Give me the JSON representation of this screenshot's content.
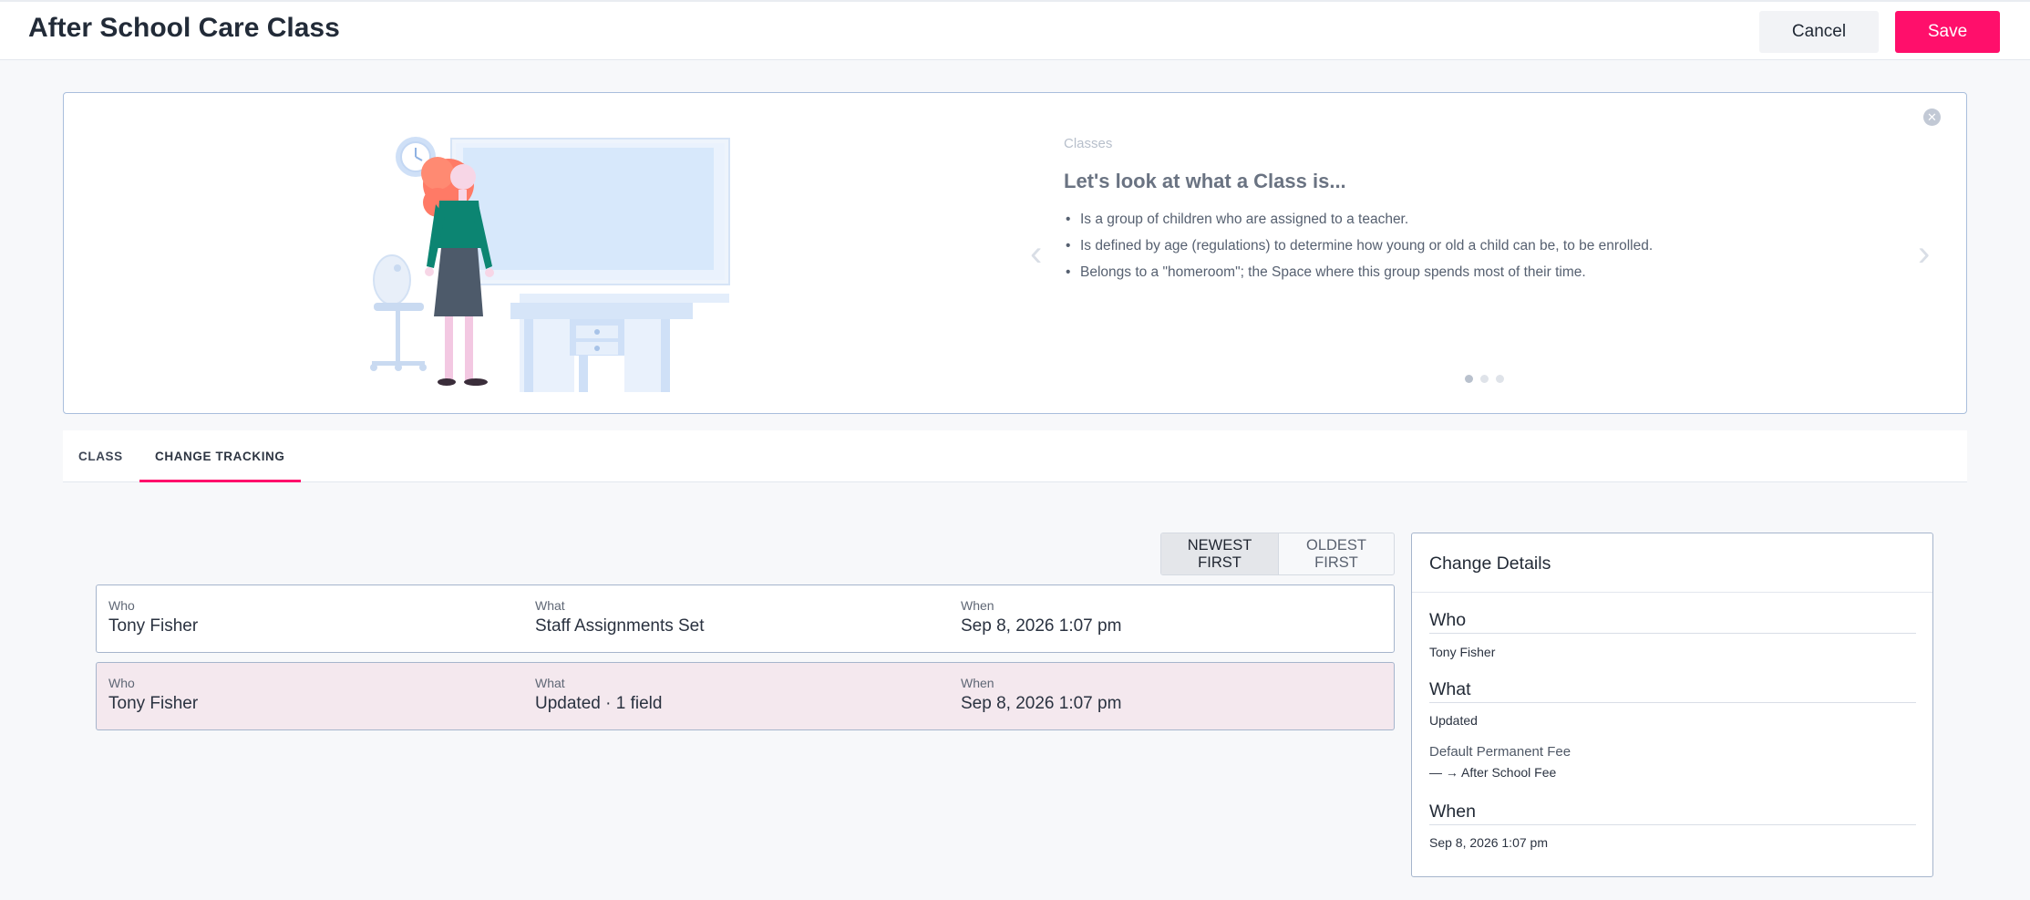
{
  "header": {
    "title": "After School Care Class",
    "cancel_label": "Cancel",
    "save_label": "Save"
  },
  "banner": {
    "kicker": "Classes",
    "heading": "Let's look at what a Class is...",
    "bullets": [
      "Is a group of children who are assigned to a teacher.",
      "Is defined by age (regulations) to determine how young or old a child can be, to be enrolled.",
      "Belongs to a \"homeroom\"; the Space where this group spends most of their time."
    ],
    "slide_count": 3,
    "active_slide": 1
  },
  "tabs": [
    {
      "label": "CLASS",
      "active": false
    },
    {
      "label": "CHANGE TRACKING",
      "active": true
    }
  ],
  "sort": {
    "newest_label": "NEWEST FIRST",
    "oldest_label": "OLDEST FIRST",
    "selected": "NEWEST FIRST"
  },
  "changes": [
    {
      "who_label": "Who",
      "who": "Tony Fisher",
      "what_label": "What",
      "what": "Staff Assignments Set",
      "when_label": "When",
      "when": "Sep 8, 2026 1:07 pm"
    },
    {
      "who_label": "Who",
      "who": "Tony Fisher",
      "what_label": "What",
      "what": "Updated · 1 field",
      "when_label": "When",
      "when": "Sep 8, 2026 1:07 pm"
    }
  ],
  "details": {
    "title": "Change Details",
    "who_heading": "Who",
    "who": "Tony Fisher",
    "what_heading": "What",
    "what": "Updated",
    "field_name": "Default Permanent Fee",
    "field_change": "— → After School Fee",
    "when_heading": "When",
    "when": "Sep 8, 2026 1:07 pm"
  },
  "colors": {
    "accent": "#ff0f6b",
    "selected_row": "#f4e8ee",
    "border": "#a6b5cc"
  }
}
